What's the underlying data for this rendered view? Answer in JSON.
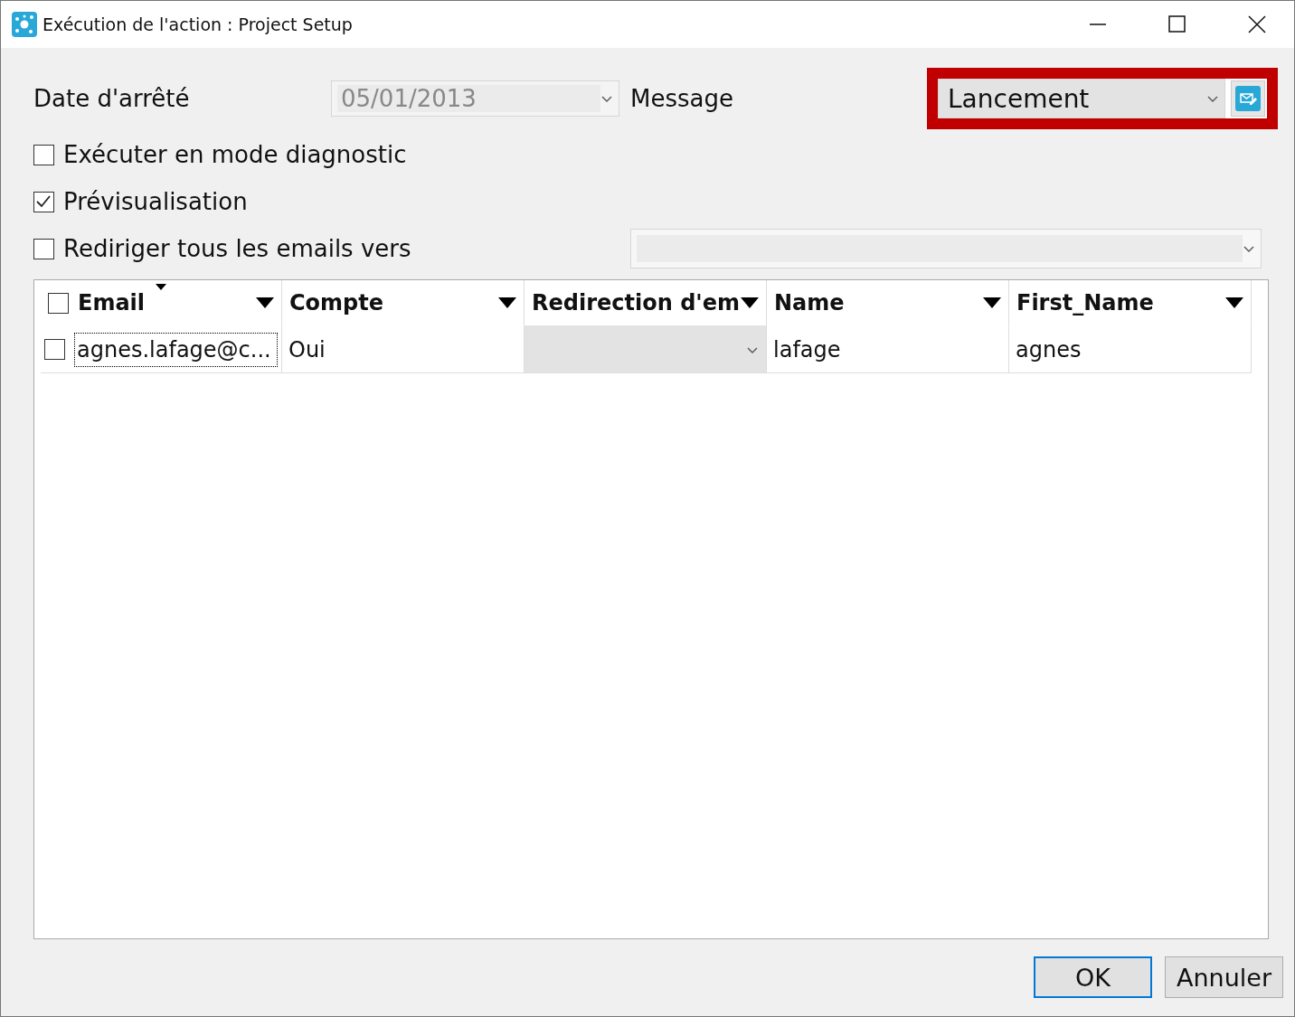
{
  "window": {
    "title": "Exécution de l'action : Project Setup"
  },
  "form": {
    "date": {
      "label": "Date d'arrêté",
      "value": "05/01/2013",
      "disabled": true
    },
    "message": {
      "label": "Message",
      "value": "Lancement",
      "highlighted": true
    }
  },
  "options": [
    {
      "label": "Exécuter en mode diagnostic",
      "checked": false
    },
    {
      "label": "Prévisualisation",
      "checked": true
    },
    {
      "label": "Rediriger tous les emails vers",
      "checked": false
    }
  ],
  "table": {
    "header_checkbox": {
      "checked": false
    },
    "columns": [
      {
        "label": "Email",
        "sorted": true
      },
      {
        "label": "Compte",
        "sorted": false
      },
      {
        "label": "Redirection d'em",
        "sorted": false
      },
      {
        "label": "Name",
        "sorted": false
      },
      {
        "label": "First_Name",
        "sorted": false
      }
    ],
    "rows": [
      {
        "checked": false,
        "cells": [
          {
            "kind": "text",
            "value": "agnes.lafage@c...",
            "focused": true
          },
          {
            "kind": "text",
            "value": "Oui",
            "focused": false
          },
          {
            "kind": "dropdown",
            "focused": false
          },
          {
            "kind": "text",
            "value": "lafage",
            "focused": false
          },
          {
            "kind": "text",
            "value": "agnes",
            "focused": false
          }
        ]
      }
    ]
  },
  "buttons": [
    {
      "label": "OK",
      "default": true
    },
    {
      "label": "Annuler",
      "default": false
    }
  ]
}
